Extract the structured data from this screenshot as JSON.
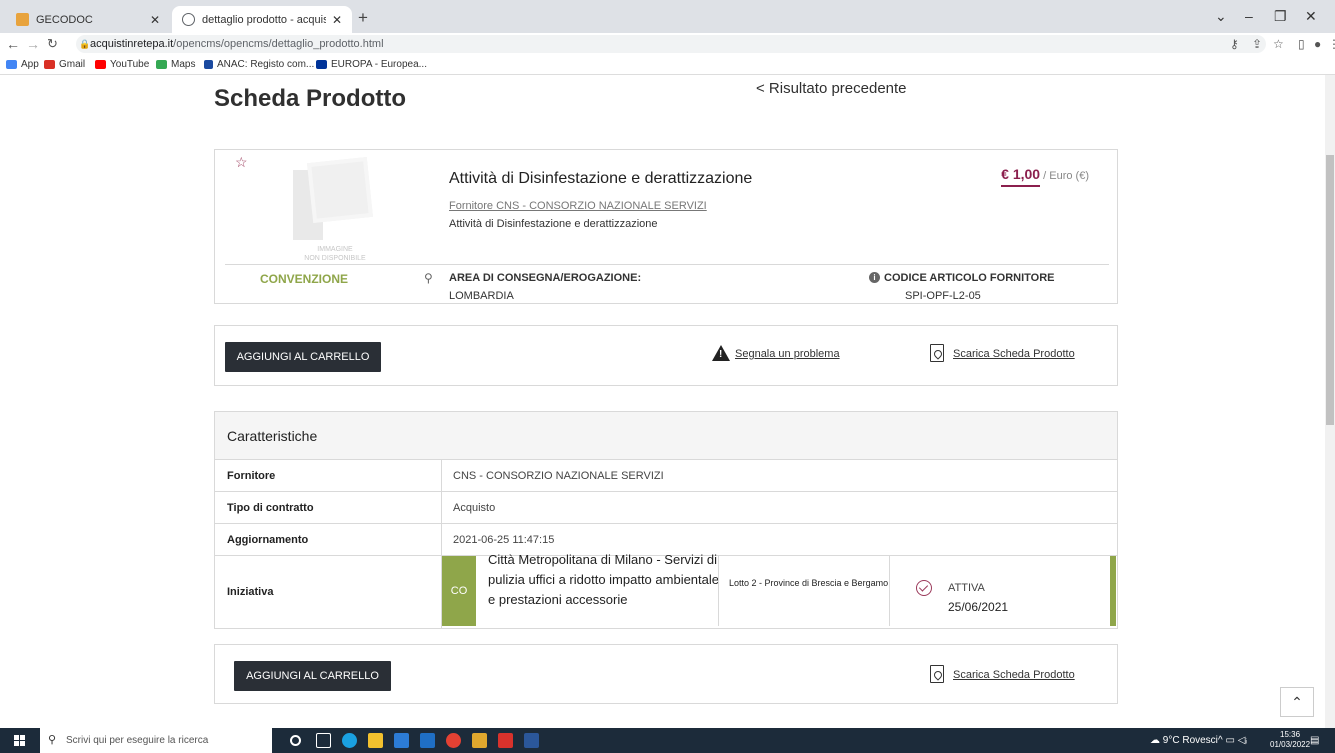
{
  "browser": {
    "tabs": [
      {
        "title": "GECODOC",
        "favicon_color": "#e8a33d"
      },
      {
        "title": "dettaglio prodotto - acquistinret",
        "favicon_color": "#5f6368"
      }
    ],
    "url_domain": "acquistinretepa.it",
    "url_path": "/opencms/opencms/dettaglio_prodotto.html",
    "bookmarks": [
      {
        "label": "App",
        "color": "#4285f4"
      },
      {
        "label": "Gmail",
        "color": "#d93025"
      },
      {
        "label": "YouTube",
        "color": "#ff0000"
      },
      {
        "label": "Maps",
        "color": "#34a853"
      },
      {
        "label": "ANAC: Registo com...",
        "color": "#1a4aa0"
      },
      {
        "label": "EUROPA - Europea...",
        "color": "#003399"
      }
    ]
  },
  "page": {
    "title": "Scheda Prodotto",
    "prev_link": "< Risultato precedente",
    "product": {
      "image_text": "IMMAGINE\nNON DISPONIBILE",
      "name": "Attività di Disinfestazione e derattizzazione",
      "supplier_link": "Fornitore CNS - CONSORZIO NAZIONALE SERVIZI",
      "description": "Attività di Disinfestazione e derattizzazione",
      "price": "€ 1,00",
      "price_unit": " / Euro (€)",
      "type": "CONVENZIONE",
      "area_label": "AREA DI CONSEGNA/EROGAZIONE:",
      "area_value": "LOMBARDIA",
      "code_label": "CODICE ARTICOLO FORNITORE",
      "code_value": "SPI-OPF-L2-05"
    },
    "actions": {
      "add_to_cart": "AGGIUNGI AL CARRELLO",
      "report_problem": "Segnala un problema",
      "download_sheet": "Scarica Scheda Prodotto"
    },
    "characteristics": {
      "header": "Caratteristiche",
      "rows": [
        {
          "key": "Fornitore",
          "value": "CNS - CONSORZIO NAZIONALE SERVIZI"
        },
        {
          "key": "Tipo di contratto",
          "value": "Acquisto"
        },
        {
          "key": "Aggiornamento",
          "value": "2021-06-25 11:47:15"
        }
      ],
      "initiative": {
        "key": "Iniziativa",
        "badge": "CO",
        "name": "Città Metropolitana di Milano - Servizi di pulizia uffici a ridotto impatto ambientale e prestazioni accessorie",
        "lot": "Lotto 2 - Province di Brescia e Bergamo",
        "status": "ATTIVA",
        "date": "25/06/2021"
      }
    }
  },
  "taskbar": {
    "search_placeholder": "Scrivi qui per eseguire la ricerca",
    "weather": "9°C Rovesci",
    "time": "15:36",
    "date": "01/03/2022"
  },
  "colors": {
    "accent": "#8b1f4d",
    "green": "#8fa64a",
    "button": "#2a2f36"
  }
}
